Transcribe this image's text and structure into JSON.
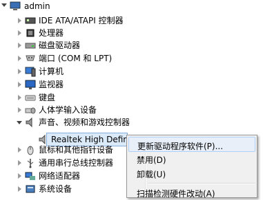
{
  "tree": {
    "root": "admin",
    "nodes": [
      {
        "label": "IDE ATA/ATAPI 控制器",
        "icon": "ide-controller-icon"
      },
      {
        "label": "处理器",
        "icon": "processor-icon"
      },
      {
        "label": "磁盘驱动器",
        "icon": "disk-drive-icon"
      },
      {
        "label": "端口 (COM 和 LPT)",
        "icon": "port-icon"
      },
      {
        "label": "计算机",
        "icon": "computer-icon"
      },
      {
        "label": "监视器",
        "icon": "monitor-icon"
      },
      {
        "label": "键盘",
        "icon": "keyboard-icon"
      },
      {
        "label": "人体学输入设备",
        "icon": "hid-icon"
      },
      {
        "label": "声音、视频和游戏控制器",
        "icon": "sound-icon"
      },
      {
        "label": "Realtek High Definition Audio",
        "icon": "speaker-icon"
      },
      {
        "label": "鼠标和其他指针设备",
        "icon": "mouse-icon"
      },
      {
        "label": "通用串行总线控制器",
        "icon": "usb-icon"
      },
      {
        "label": "网络适配器",
        "icon": "network-adapter-icon"
      },
      {
        "label": "系统设备",
        "icon": "system-device-icon"
      }
    ]
  },
  "context_menu": {
    "items": [
      {
        "label": "更新驱动程序软件(P)..."
      },
      {
        "label": "禁用(D)"
      },
      {
        "label": "卸载(U)"
      },
      {
        "label": "扫描检测硬件改动(A)"
      }
    ]
  },
  "colors": {
    "selection": "#dbeaf9",
    "selection_border": "#84acdd",
    "menu_bg": "#f0f0f0"
  }
}
